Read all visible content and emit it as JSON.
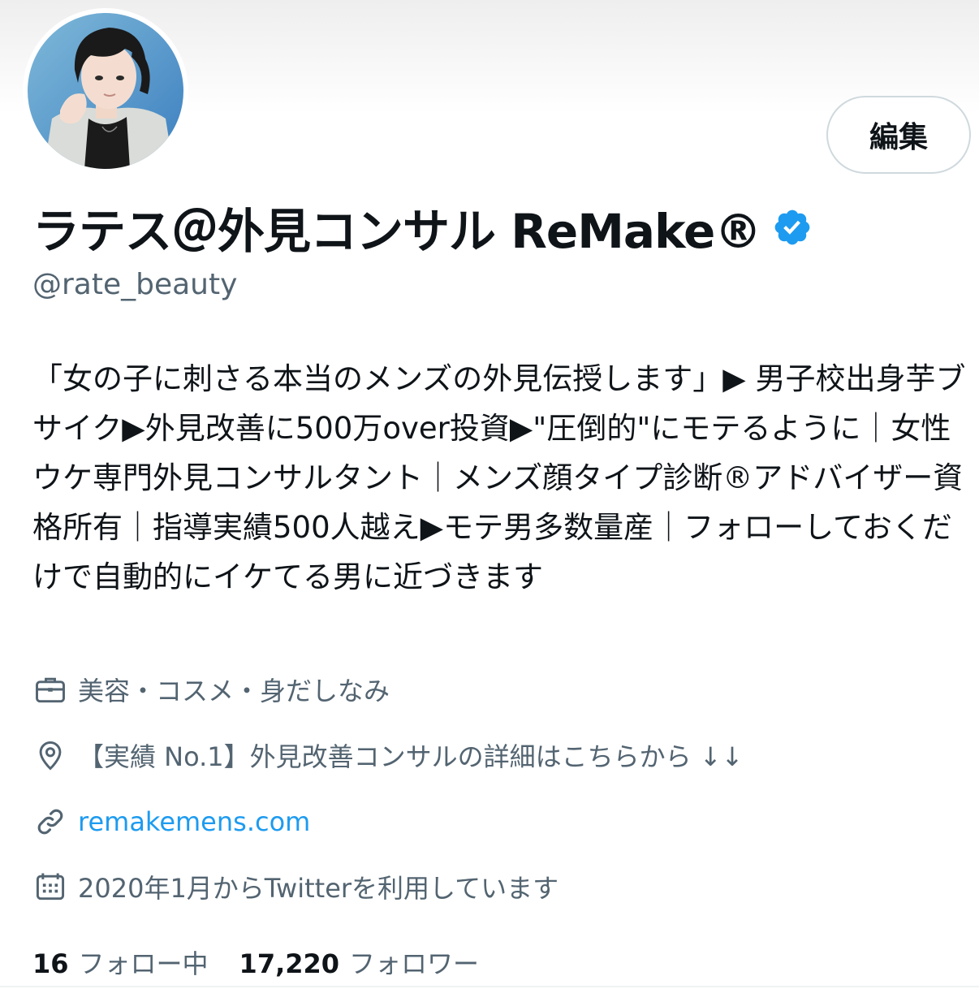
{
  "profile": {
    "edit_label": "編集",
    "display_name": "ラテス＠外見コンサル ReMake®",
    "handle": "@rate_beauty",
    "bio": "「女の子に刺さる本当のメンズの外見伝授します」▶ 男子校出身芋ブサイク▶外見改善に500万over投資▶\"圧倒的\"にモテるように｜女性ウケ専門外見コンサルタント｜メンズ顔タイプ診断®アドバイザー資格所有｜指導実績500人越え▶モテ男多数量産｜フォローしておくだけで自動的にイケてる男に近づきます",
    "category": "美容・コスメ・身だしなみ",
    "location": "【実績 No.1】外見改善コンサルの詳細はこちらから ↓↓",
    "url": "remakemens.com",
    "joined": "2020年1月からTwitterを利用しています",
    "following_count": "16",
    "following_label": "フォロー中",
    "followers_count": "17,220",
    "followers_label": "フォロワー"
  },
  "icons": {
    "verified": "verified-badge-icon",
    "category": "briefcase-icon",
    "location": "location-pin-icon",
    "url": "link-icon",
    "joined": "calendar-icon"
  },
  "colors": {
    "accent": "#1d9bf0",
    "text": "#0f1419",
    "secondary_text": "#536471",
    "border": "#cfd9de"
  }
}
